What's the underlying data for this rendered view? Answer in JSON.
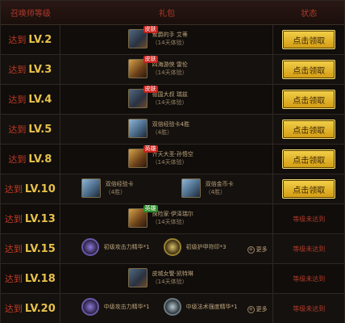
{
  "header": {
    "level": "召唤师等级",
    "gift": "礼包",
    "status": "状态"
  },
  "prefix": "达到",
  "rows": [
    {
      "level": "LV.2",
      "status": "点击领取",
      "gifts": [
        {
          "tag": "皮肤",
          "name": "索爵的手 艾蒂",
          "sub": "（14天体验）"
        }
      ]
    },
    {
      "level": "LV.3",
      "status": "点击领取",
      "gifts": [
        {
          "tag": "皮肤",
          "name": "四海游侠 雷伦",
          "sub": "（14天体验）"
        }
      ]
    },
    {
      "level": "LV.4",
      "status": "点击领取",
      "gifts": [
        {
          "tag": "皮肤",
          "name": "德国大叔 瑞兹",
          "sub": "（14天体验）"
        }
      ]
    },
    {
      "level": "LV.5",
      "status": "点击领取",
      "gifts": [
        {
          "tag": "",
          "name": "双倍经验卡4胜",
          "sub": "（4胜）"
        }
      ]
    },
    {
      "level": "LV.8",
      "status": "点击领取",
      "gifts": [
        {
          "tag": "英雄",
          "name": "齐天大圣·孙悟空",
          "sub": "（14天体验）"
        }
      ]
    },
    {
      "level": "LV.10",
      "status": "点击领取",
      "gifts": [
        {
          "tag": "",
          "name": "双倍经验卡",
          "sub": "（4胜）"
        },
        {
          "tag": "",
          "name": "双倍金币卡",
          "sub": "（4胜）"
        }
      ]
    },
    {
      "level": "LV.13",
      "status": "等级未达到",
      "gifts": [
        {
          "tag": "英雄",
          "name": "探险家·伊泽瑞尔",
          "sub": "（14天体验）"
        }
      ]
    },
    {
      "level": "LV.15",
      "status": "等级未达到",
      "gifts": [
        {
          "tag": "",
          "name": "初级攻击力精华*1",
          "sub": ""
        },
        {
          "tag": "",
          "name": "初级护甲符印*3",
          "sub": ""
        }
      ],
      "more": "更多"
    },
    {
      "level": "LV.18",
      "status": "等级未达到",
      "gifts": [
        {
          "tag": "",
          "name": "皮城女警·凯特琳",
          "sub": "（14天体验）"
        }
      ]
    },
    {
      "level": "LV.20",
      "status": "等级未达到",
      "gifts": [
        {
          "tag": "",
          "name": "中级攻击力精华*1",
          "sub": ""
        },
        {
          "tag": "",
          "name": "中级法术强度精华*1",
          "sub": ""
        }
      ],
      "more": "更多"
    }
  ]
}
